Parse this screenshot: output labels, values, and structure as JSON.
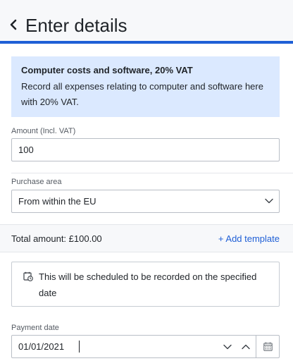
{
  "header": {
    "title": "Enter details",
    "back_icon": "chevron-left-icon",
    "accent_color": "#1f5fd6"
  },
  "info_box": {
    "title": "Computer costs and software, 20% VAT",
    "body": "Record all expenses relating to computer and software here with 20% VAT.",
    "background": "#dbe9ff"
  },
  "amount": {
    "label": "Amount (Incl. VAT)",
    "value": "100"
  },
  "purchase_area": {
    "label": "Purchase area",
    "selected": "From within the EU",
    "icon": "chevron-down-icon"
  },
  "summary": {
    "total_text": "Total amount: £100.00",
    "add_template_label": "+ Add template",
    "link_color": "#1f5fd6"
  },
  "notice": {
    "icon": "calendar-clock-icon",
    "text": "This will be scheduled to be recorded on the specified date"
  },
  "payment_date": {
    "label": "Payment date",
    "value": "01/01/2021",
    "decrement_icon": "chevron-down-icon",
    "increment_icon": "chevron-up-icon",
    "calendar_icon": "calendar-icon"
  }
}
